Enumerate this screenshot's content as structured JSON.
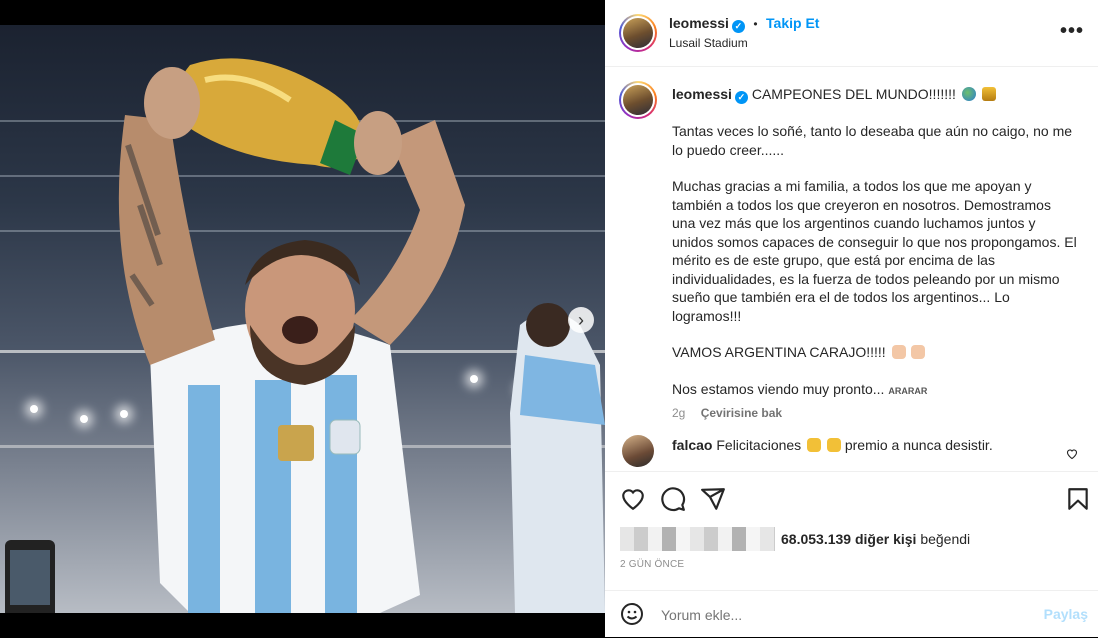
{
  "post": {
    "username": "leomessi",
    "follow_label": "Takip Et",
    "separator": "•",
    "location": "Lusail Stadium",
    "more_glyph": "•••",
    "verified_glyph": "✓"
  },
  "caption": {
    "username": "leomessi",
    "title": "CAMPEONES DEL MUNDO!!!!!!!",
    "paragraphs": [
      "Tantas veces lo soñé, tanto lo deseaba que aún no caigo, no me lo puedo creer......",
      "Muchas gracias a mi familia, a todos los que me apoyan y también a todos los que creyeron en nosotros. Demostramos una vez más que los argentinos cuando luchamos juntos y unidos somos capaces de conseguir lo que nos propongamos. El mérito es de este grupo, que está por encima de las individualidades, es la fuerza de todos peleando por un mismo sueño que también era el de todos los argentinos... Lo logramos!!!",
      "VAMOS ARGENTINA CARAJO!!!!!",
      "Nos estamos viendo muy pronto..."
    ],
    "ararar": "ARARAR",
    "age": "2g",
    "see_translation": "Çevirisine bak"
  },
  "comment": {
    "username": "falcao",
    "text_before": "Felicitaciones",
    "text_after": "premio a nunca desistir."
  },
  "likes": {
    "count": "68.053.139",
    "rest": "diğer kişi",
    "liked": "beğendi"
  },
  "date_label": "2 GÜN ÖNCE",
  "comment_input": {
    "placeholder": "Yorum ekle...",
    "post_label": "Paylaş"
  },
  "carousel": {
    "slides": 10,
    "active": 0
  },
  "icons": [
    "heart-icon",
    "comment-icon",
    "share-icon",
    "bookmark-icon",
    "emoji-icon",
    "chevron-right-icon",
    "verified-icon"
  ],
  "colors": {
    "accent": "#0095f6",
    "text": "#262626",
    "muted": "#8e8e8e"
  }
}
